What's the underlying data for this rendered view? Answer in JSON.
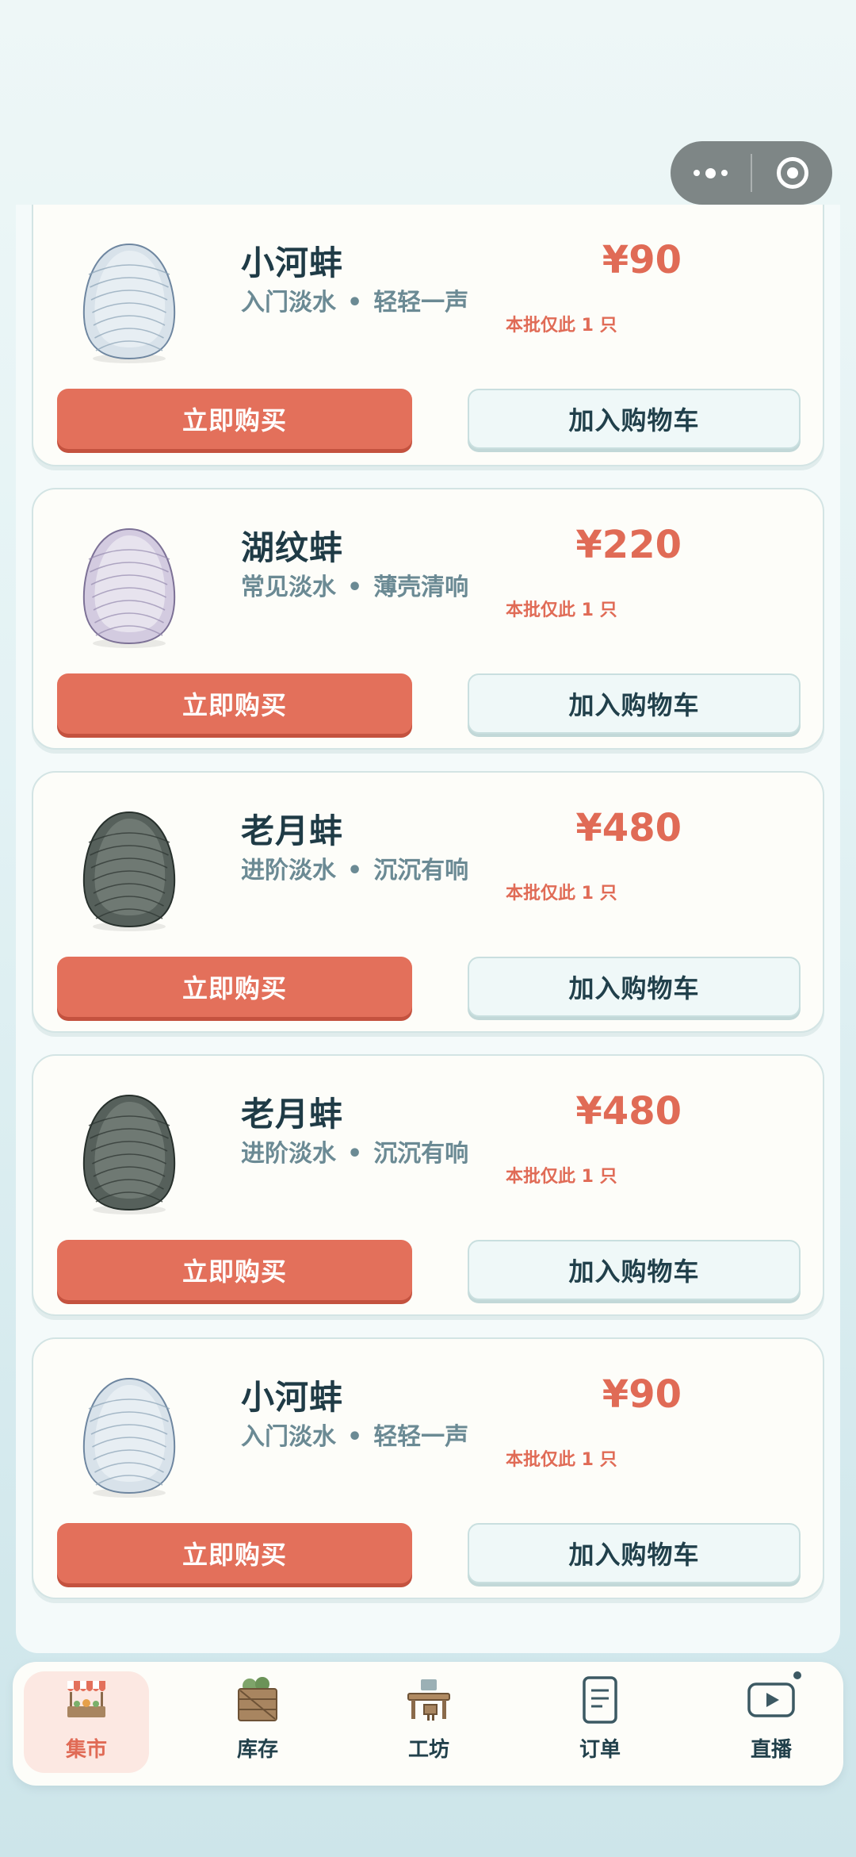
{
  "colors": {
    "accent": "#e3705b",
    "price": "#e06b56",
    "text_dark": "#1f3b46",
    "text_muted": "#6b8a94"
  },
  "products": [
    {
      "name": "小河蚌",
      "tier": "入门淡水",
      "sep": "•",
      "sound": "轻轻一声",
      "price": "¥90",
      "stock": "本批仅此 1 只",
      "buy": "立即购买",
      "cart": "加入购物车",
      "shell": "light"
    },
    {
      "name": "湖纹蚌",
      "tier": "常见淡水",
      "sep": "•",
      "sound": "薄壳清响",
      "price": "¥220",
      "stock": "本批仅此 1 只",
      "buy": "立即购买",
      "cart": "加入购物车",
      "shell": "lilac"
    },
    {
      "name": "老月蚌",
      "tier": "进阶淡水",
      "sep": "•",
      "sound": "沉沉有响",
      "price": "¥480",
      "stock": "本批仅此 1 只",
      "buy": "立即购买",
      "cart": "加入购物车",
      "shell": "dark"
    },
    {
      "name": "老月蚌",
      "tier": "进阶淡水",
      "sep": "•",
      "sound": "沉沉有响",
      "price": "¥480",
      "stock": "本批仅此 1 只",
      "buy": "立即购买",
      "cart": "加入购物车",
      "shell": "dark"
    },
    {
      "name": "小河蚌",
      "tier": "入门淡水",
      "sep": "•",
      "sound": "轻轻一声",
      "price": "¥90",
      "stock": "本批仅此 1 只",
      "buy": "立即购买",
      "cart": "加入购物车",
      "shell": "light"
    }
  ],
  "tabs": [
    {
      "label": "集市",
      "icon": "market-stall-icon",
      "active": true
    },
    {
      "label": "库存",
      "icon": "crate-icon",
      "active": false
    },
    {
      "label": "工坊",
      "icon": "workbench-icon",
      "active": false
    },
    {
      "label": "订单",
      "icon": "order-list-icon",
      "active": false
    },
    {
      "label": "直播",
      "icon": "live-play-icon",
      "active": false
    }
  ]
}
